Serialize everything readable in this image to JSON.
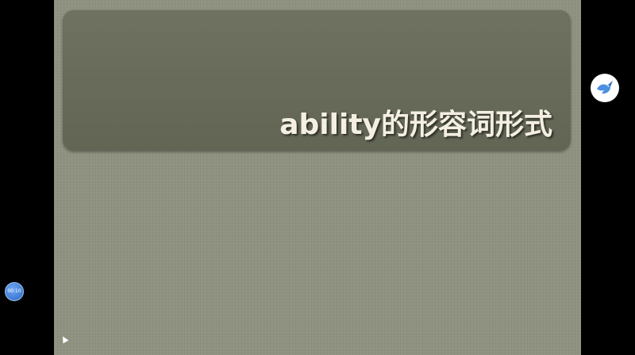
{
  "slide": {
    "title": "ability的形容词形式"
  },
  "overlay": {
    "bird_icon": "bird-icon",
    "time_label": "00:10"
  },
  "colors": {
    "slide_background": "#8f9280",
    "title_band": "#6a6d5c",
    "title_text": "#f4efe2",
    "accent_blue": "#2a66c8"
  }
}
